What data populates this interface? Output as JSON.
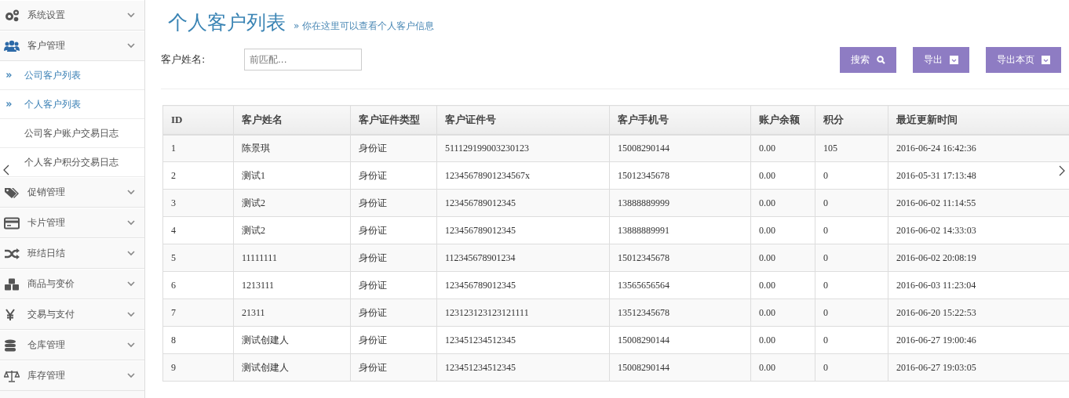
{
  "sidebar": {
    "items": [
      {
        "label": "系统设置"
      },
      {
        "label": "客户管理",
        "children": [
          {
            "label": "公司客户列表",
            "selected": true
          },
          {
            "label": "个人客户列表",
            "selected": true
          },
          {
            "label": "公司客户账户交易日志",
            "selected": false
          },
          {
            "label": "个人客户积分交易日志",
            "selected": false
          }
        ]
      },
      {
        "label": "促销管理"
      },
      {
        "label": "卡片管理"
      },
      {
        "label": "班结日结"
      },
      {
        "label": "商品与变价"
      },
      {
        "label": "交易与支付"
      },
      {
        "label": "仓库管理"
      },
      {
        "label": "库存管理"
      }
    ]
  },
  "page": {
    "title": "个人客户列表",
    "subtitle": "» 你在这里可以查看个人客户信息"
  },
  "filter": {
    "label": "客户姓名:",
    "placeholder": "前匹配..."
  },
  "buttons": [
    {
      "label": "搜索",
      "kind": "search"
    },
    {
      "label": "导出",
      "kind": "export"
    },
    {
      "label": "导出本页",
      "kind": "export"
    }
  ],
  "table": {
    "columns": [
      "ID",
      "客户姓名",
      "客户证件类型",
      "客户证件号",
      "客户手机号",
      "账户余额",
      "积分",
      "最近更新时间"
    ],
    "rows": [
      [
        "1",
        "陈景琪",
        "身份证",
        "511129199003230123",
        "15008290144",
        "0.00",
        "105",
        "2016-06-24 16:42:36"
      ],
      [
        "2",
        "测试1",
        "身份证",
        "12345678901234567x",
        "15012345678",
        "0.00",
        "0",
        "2016-05-31 17:13:48"
      ],
      [
        "3",
        "测试2",
        "身份证",
        "123456789012345",
        "13888889999",
        "0.00",
        "0",
        "2016-06-02 11:14:55"
      ],
      [
        "4",
        "测试2",
        "身份证",
        "123456789012345",
        "13888889991",
        "0.00",
        "0",
        "2016-06-02 14:33:03"
      ],
      [
        "5",
        "11111111",
        "身份证",
        "112345678901234",
        "15012345678",
        "0.00",
        "0",
        "2016-06-02 20:08:19"
      ],
      [
        "6",
        "1213111",
        "身份证",
        "123456789012345",
        "13565656564",
        "0.00",
        "0",
        "2016-06-03 11:23:04"
      ],
      [
        "7",
        "21311",
        "身份证",
        "123123123123121111",
        "13512345678",
        "0.00",
        "0",
        "2016-06-20 15:22:53"
      ],
      [
        "8",
        "测试创建人",
        "身份证",
        "123451234512345",
        "15008290144",
        "0.00",
        "0",
        "2016-06-27 19:00:46"
      ],
      [
        "9",
        "测试创建人",
        "身份证",
        "123451234512345",
        "15008290144",
        "0.00",
        "0",
        "2016-06-27 19:03:05"
      ]
    ]
  }
}
